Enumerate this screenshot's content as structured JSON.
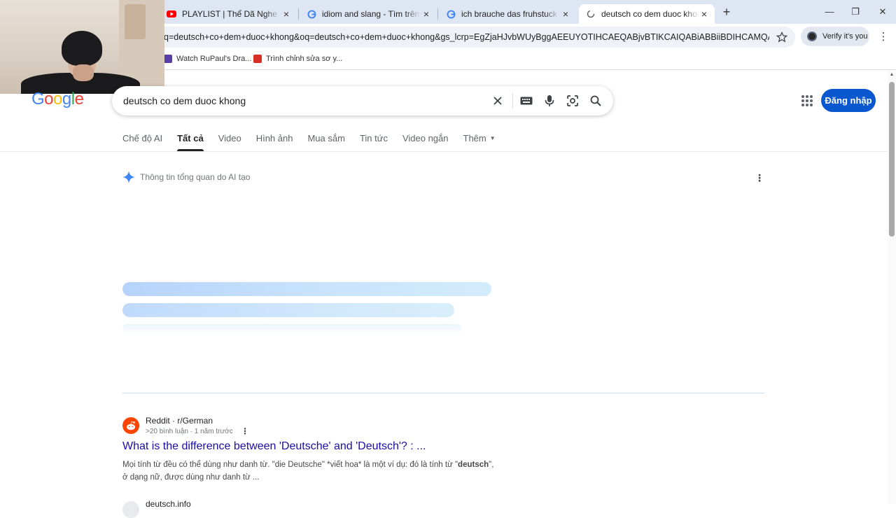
{
  "browser": {
    "tabs": [
      {
        "title": "PLAYLIST | Thể Dã Nghe Nhạc Đ",
        "icon": "youtube-icon"
      },
      {
        "title": "idiom and slang - Tìm trên Goo",
        "icon": "google-icon"
      },
      {
        "title": "ich brauche das fruhstuck zu es",
        "icon": "google-icon"
      },
      {
        "title": "deutsch co dem duoc khong - T",
        "icon": "loading-icon",
        "active": true
      }
    ],
    "url": "q=deutsch+co+dem+duoc+khong&oq=deutsch+co+dem+duoc+khong&gs_lcrp=EgZjaHJvbWUyBggAEEUYOTIHCAEQABjvBTIKCAIQABiABBiiBDIHCAMQABjvBTIHCA...",
    "verify_label": "Verify it's you",
    "bookmarks": [
      {
        "label": "Watch RuPaul's Dra...",
        "color": "#5b3fa8"
      },
      {
        "label": "Trình chỉnh sửa sơ y...",
        "color": "#d93025"
      }
    ]
  },
  "google": {
    "logo_letters": [
      "G",
      "o",
      "o",
      "g",
      "l",
      "e"
    ],
    "logo_colors": [
      "#4285f4",
      "#ea4335",
      "#fbbc05",
      "#4285f4",
      "#34a853",
      "#ea4335"
    ],
    "query": "deutsch co dem duoc khong",
    "signin_label": "Đăng nhập",
    "tabs": [
      {
        "label": "Chế độ AI"
      },
      {
        "label": "Tất cả",
        "active": true
      },
      {
        "label": "Video"
      },
      {
        "label": "Hình ảnh"
      },
      {
        "label": "Mua sắm"
      },
      {
        "label": "Tin tức"
      },
      {
        "label": "Video ngắn"
      },
      {
        "label": "Thêm"
      }
    ],
    "ai_overview_label": "Thông tin tổng quan do AI tạo",
    "results": [
      {
        "source": "Reddit · r/German",
        "meta": ">20 bình luận · 1 năm trước",
        "title": "What is the difference between 'Deutsche' and 'Deutsch'? : ...",
        "snippet_line1_pre": "Mọi tính từ đều có thể dùng như danh từ. \"die Deutsche\" *viết hoa* là một ví dụ: đó là tính từ \"",
        "snippet_bold": "deutsch",
        "snippet_line1_post": "\",",
        "snippet_line2": "ở dạng nữ, được dùng như danh từ ..."
      },
      {
        "source": "deutsch.info"
      }
    ]
  }
}
